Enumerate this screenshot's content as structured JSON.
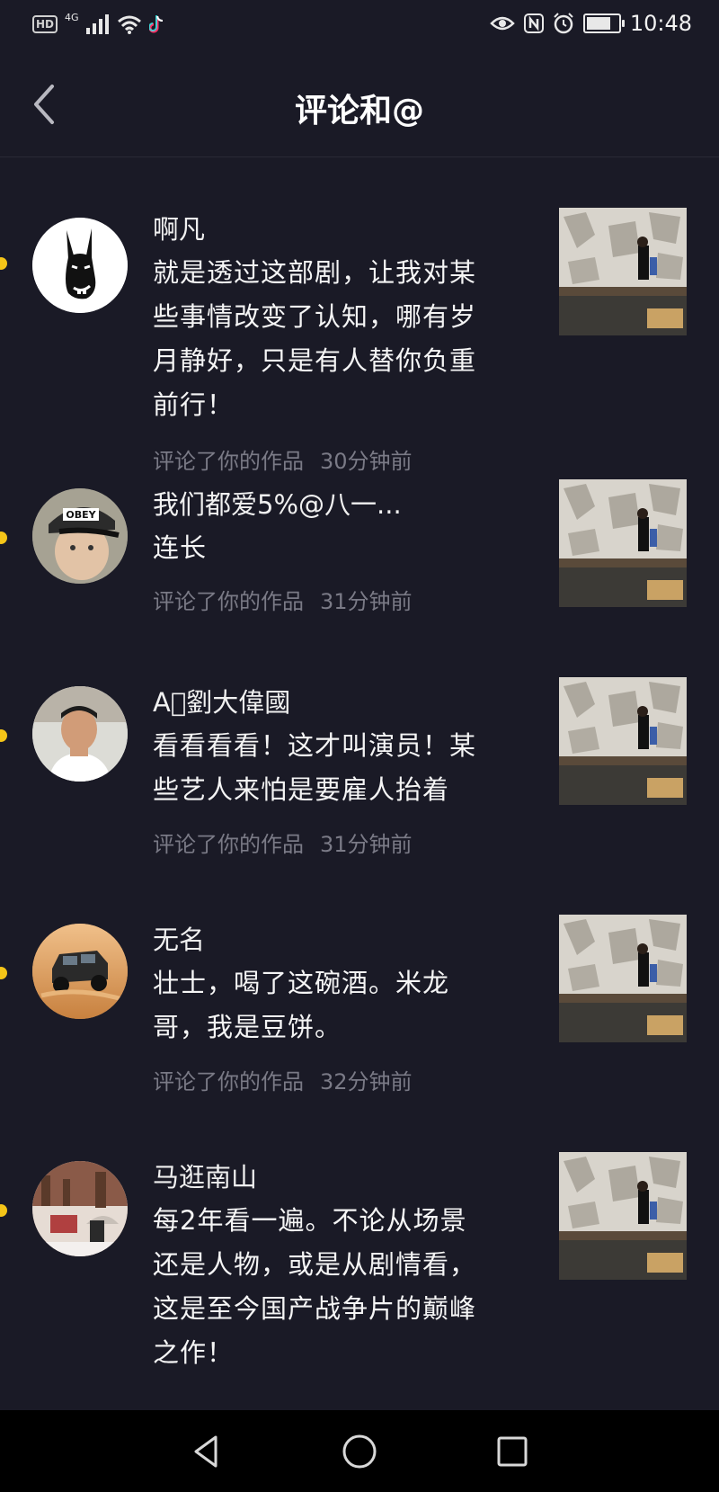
{
  "status_bar": {
    "hd": "HD",
    "network": "4G",
    "time": "10:48"
  },
  "header": {
    "title": "评论和@",
    "back_icon": "chevron-left-icon"
  },
  "comments": [
    {
      "name": "啊凡",
      "lines": [
        "就是透过这部剧，让我对某",
        "些事情改变了认知，哪有岁",
        "月静好，只是有人替你负重",
        "前行！"
      ],
      "action": "评论了你的作品",
      "time": "30分钟前",
      "avatar": "donkey-avatar"
    },
    {
      "name": "我们都爱5%@八一...",
      "lines": [
        "连长"
      ],
      "action": "评论了你的作品",
      "time": "31分钟前",
      "avatar": "obey-cap-avatar"
    },
    {
      "name": "A\u0000劉大偉國",
      "lines": [
        "看看看看！这才叫演员！某",
        "些艺人来怕是要雇人抬着"
      ],
      "action": "评论了你的作品",
      "time": "31分钟前",
      "avatar": "man-portrait-avatar"
    },
    {
      "name": "无名",
      "lines": [
        "壮士，喝了这碗酒。米龙",
        "哥，我是豆饼。"
      ],
      "action": "评论了你的作品",
      "time": "32分钟前",
      "avatar": "jeep-avatar"
    },
    {
      "name": "马逛南山",
      "lines": [
        "每2年看一遍。不论从场景",
        "还是人物，或是从剧情看，",
        "这是至今国产战争片的巅峰",
        "之作！"
      ],
      "action": "",
      "time": "",
      "avatar": "scene-avatar"
    }
  ],
  "colors": {
    "background": "#1a1a26",
    "unread_dot": "#f5c518",
    "meta_text": "#7a7a86"
  },
  "navbar": {
    "back": "triangle-back-icon",
    "home": "circle-home-icon",
    "recents": "square-recents-icon"
  }
}
